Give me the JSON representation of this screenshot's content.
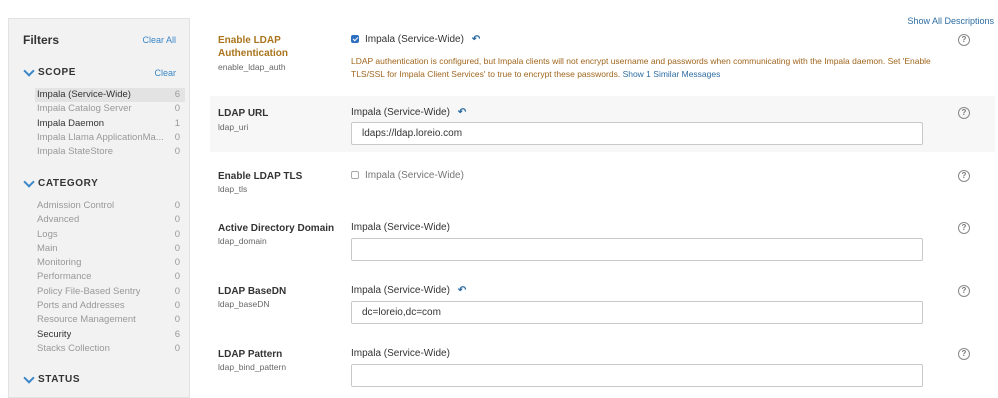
{
  "filters": {
    "title": "Filters",
    "clear_all": "Clear All",
    "scope": {
      "heading": "SCOPE",
      "clear": "Clear",
      "items": [
        {
          "label": "Impala (Service-Wide)",
          "count": "6"
        },
        {
          "label": "Impala Catalog Server",
          "count": "0"
        },
        {
          "label": "Impala Daemon",
          "count": "1"
        },
        {
          "label": "Impala Llama ApplicationMa...",
          "count": "0"
        },
        {
          "label": "Impala StateStore",
          "count": "0"
        }
      ]
    },
    "category": {
      "heading": "CATEGORY",
      "items": [
        {
          "label": "Admission Control",
          "count": "0"
        },
        {
          "label": "Advanced",
          "count": "0"
        },
        {
          "label": "Logs",
          "count": "0"
        },
        {
          "label": "Main",
          "count": "0"
        },
        {
          "label": "Monitoring",
          "count": "0"
        },
        {
          "label": "Performance",
          "count": "0"
        },
        {
          "label": "Policy File-Based Sentry",
          "count": "0"
        },
        {
          "label": "Ports and Addresses",
          "count": "0"
        },
        {
          "label": "Resource Management",
          "count": "0"
        },
        {
          "label": "Security",
          "count": "6"
        },
        {
          "label": "Stacks Collection",
          "count": "0"
        }
      ]
    },
    "status": {
      "heading": "STATUS"
    }
  },
  "main": {
    "show_all_descriptions": "Show All Descriptions",
    "undo_icon": "↶",
    "help_icon": "?",
    "settings": [
      {
        "name": "Enable LDAP Authentication",
        "key": "enable_ldap_auth",
        "scope": "Impala (Service-Wide)",
        "checked": true,
        "warning": "LDAP authentication is configured, but Impala clients will not encrypt username and passwords when communicating with the Impala daemon. Set 'Enable TLS/SSL for Impala Client Services' to true to encrypt these passwords.",
        "similar_link": "Show 1 Similar Messages"
      },
      {
        "name": "LDAP URL",
        "key": "ldap_uri",
        "scope": "Impala (Service-Wide)",
        "value": "ldaps://ldap.loreio.com"
      },
      {
        "name": "Enable LDAP TLS",
        "key": "ldap_tls",
        "scope": "Impala (Service-Wide)",
        "checked": false
      },
      {
        "name": "Active Directory Domain",
        "key": "ldap_domain",
        "scope": "Impala (Service-Wide)",
        "value": ""
      },
      {
        "name": "LDAP BaseDN",
        "key": "ldap_baseDN",
        "scope": "Impala (Service-Wide)",
        "value": "dc=loreio,dc=com"
      },
      {
        "name": "LDAP Pattern",
        "key": "ldap_bind_pattern",
        "scope": "Impala (Service-Wide)",
        "value": ""
      }
    ]
  }
}
